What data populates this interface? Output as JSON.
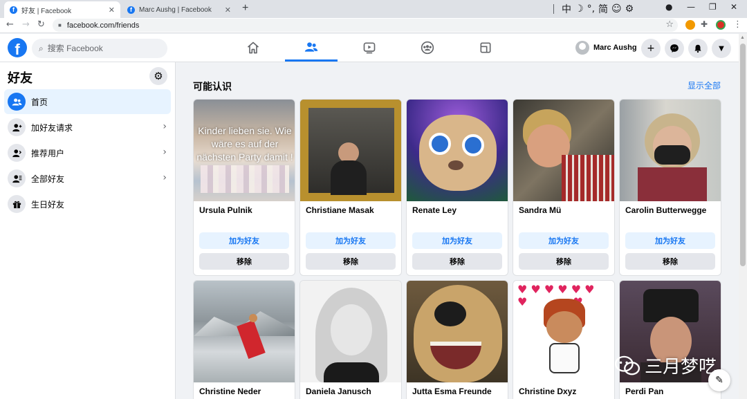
{
  "browser": {
    "tabs": [
      {
        "title": "好友 | Facebook",
        "close": "✕"
      },
      {
        "title": "Marc Aushg | Facebook",
        "close": "✕"
      }
    ],
    "new_tab": "+",
    "url": "facebook.com/friends",
    "tray_items": [
      "中",
      "☽",
      "°,",
      "简",
      "☺",
      "⚙"
    ]
  },
  "fb_header": {
    "logo": "f",
    "search_placeholder": "搜索 Facebook",
    "nav_tabs": [
      "home-icon",
      "friends-icon",
      "watch-icon",
      "groups-icon",
      "gaming-icon"
    ],
    "active_tab": "friends-icon",
    "profile_name": "Marc Aushg",
    "actions": [
      "create-icon",
      "messenger-icon",
      "notifications-icon",
      "account-menu-icon"
    ]
  },
  "sidebar": {
    "title": "好友",
    "items": [
      {
        "label": "首页",
        "icon": "friends-icon",
        "active": true
      },
      {
        "label": "加好友请求",
        "icon": "friend-request-icon",
        "chevron": true
      },
      {
        "label": "推荐用户",
        "icon": "suggestions-icon",
        "chevron": true
      },
      {
        "label": "全部好友",
        "icon": "all-friends-icon",
        "chevron": true
      },
      {
        "label": "生日好友",
        "icon": "gift-icon"
      }
    ]
  },
  "main": {
    "heading": "可能认识",
    "see_all": "显示全部",
    "add_label": "加为好友",
    "remove_label": "移除",
    "people_row1": [
      {
        "name": "Ursula Pulnik",
        "photo_text": "Kinder lieben sie. Wie wäre es auf der nächsten Party damit !"
      },
      {
        "name": "Christiane Masak"
      },
      {
        "name": "Renate Ley"
      },
      {
        "name": "Sandra Mü"
      },
      {
        "name": "Carolin Butterwegge"
      }
    ],
    "people_row2": [
      {
        "name": "Christine Neder"
      },
      {
        "name": "Daniela Janusch"
      },
      {
        "name": "Jutta Esma Freunde"
      },
      {
        "name": "Christine Dxyz"
      },
      {
        "name": "Perdi Pan"
      }
    ]
  },
  "watermark": "三月梦呓",
  "colors": {
    "brand": "#1877f2",
    "page_bg": "#f0f2f5",
    "active_bg": "#e7f3ff"
  }
}
